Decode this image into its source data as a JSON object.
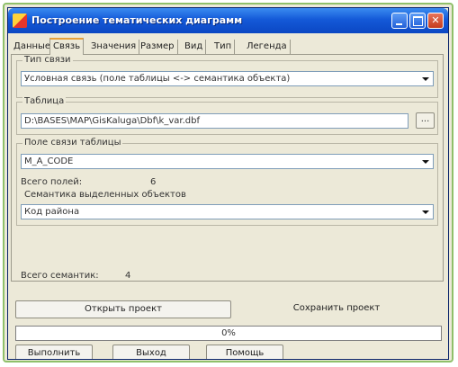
{
  "window": {
    "title": "Построение тематических диаграмм"
  },
  "tabs": [
    {
      "label": "Данные"
    },
    {
      "label": "Связь"
    },
    {
      "label": "Значения"
    },
    {
      "label": "Размер"
    },
    {
      "label": "Вид"
    },
    {
      "label": "Тип"
    },
    {
      "label": "Легенда"
    }
  ],
  "link_type": {
    "label": "Тип связи",
    "value": "Условная связь (поле таблицы <-> семантика объекта)"
  },
  "table": {
    "label": "Таблица",
    "path": "D:\\BASES\\MAP\\GisKaluga\\Dbf\\k_var.dbf",
    "browse_label": "..."
  },
  "link_field": {
    "label": "Поле связи таблицы",
    "value": "M_A_CODE",
    "total_label": "Всего полей:",
    "total_value": "6"
  },
  "semantics": {
    "label": "Семантика выделенных объектов",
    "value": "Код района",
    "total_label": "Всего семантик:",
    "total_value": "4"
  },
  "project": {
    "open_label": "Открыть проект",
    "save_label": "Сохранить проект"
  },
  "progress": {
    "value": 0,
    "text": "0%"
  },
  "footer": {
    "run_label": "Выполнить",
    "exit_label": "Выход",
    "help_label": "Помощь"
  }
}
